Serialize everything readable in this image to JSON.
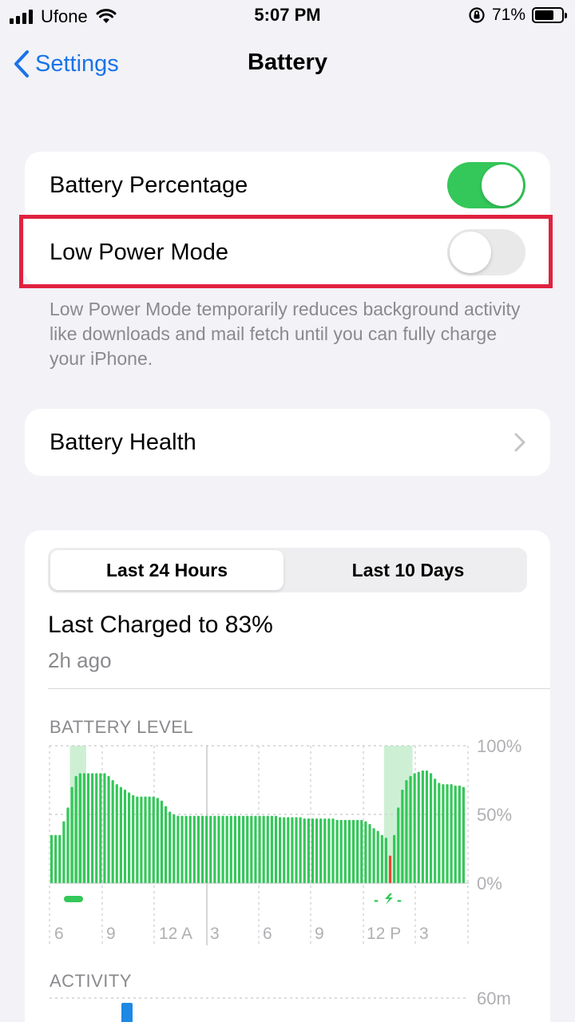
{
  "status_bar": {
    "carrier": "Ufone",
    "time": "5:07 PM",
    "battery_percent": "71%",
    "battery_level": 0.71
  },
  "nav": {
    "back_label": "Settings",
    "title": "Battery"
  },
  "toggles": {
    "battery_percentage_label": "Battery Percentage",
    "battery_percentage_on": true,
    "low_power_label": "Low Power Mode",
    "low_power_on": false
  },
  "footnote": "Low Power Mode temporarily reduces background activity like downloads and mail fetch until you can fully charge your iPhone.",
  "battery_health_label": "Battery Health",
  "usage": {
    "tabs": [
      "Last 24 Hours",
      "Last 10 Days"
    ],
    "active_tab": 0,
    "last_charged": "Last Charged to 83%",
    "last_charged_ago": "2h ago",
    "battery_level_label": "BATTERY LEVEL",
    "activity_label": "ACTIVITY",
    "activity_top_tick": "60m"
  },
  "colors": {
    "accent_blue": "#1a73e8",
    "toggle_green": "#34c759",
    "bar_green": "#34c759",
    "charging_band": "#cdf0d4",
    "low_bar_red": "#e8472f",
    "highlight_red": "#e0223f"
  },
  "chart_data": {
    "type": "bar",
    "title": "BATTERY LEVEL",
    "y_ticks": [
      "100%",
      "50%",
      "0%"
    ],
    "ylim": [
      0,
      100
    ],
    "x_ticks": [
      "6",
      "9",
      "12 A",
      "3",
      "6",
      "9",
      "12 P",
      "3"
    ],
    "values": [
      35,
      35,
      35,
      45,
      55,
      70,
      78,
      80,
      80,
      80,
      80,
      80,
      80,
      80,
      78,
      75,
      72,
      70,
      68,
      66,
      64,
      63,
      63,
      63,
      63,
      63,
      62,
      60,
      56,
      52,
      50,
      49,
      49,
      49,
      49,
      49,
      49,
      49,
      49,
      49,
      49,
      49,
      49,
      49,
      49,
      49,
      49,
      49,
      49,
      49,
      49,
      49,
      49,
      49,
      49,
      49,
      48,
      48,
      48,
      48,
      48,
      48,
      47,
      47,
      47,
      47,
      47,
      47,
      47,
      47,
      46,
      46,
      46,
      46,
      46,
      46,
      46,
      45,
      43,
      40,
      38,
      35,
      33,
      20,
      35,
      55,
      68,
      75,
      78,
      80,
      81,
      82,
      82,
      80,
      76,
      73,
      72,
      72,
      72,
      71,
      71,
      70
    ],
    "low_bar_index": 83,
    "charging_bands": [
      [
        5,
        9
      ],
      [
        82,
        89
      ]
    ]
  }
}
